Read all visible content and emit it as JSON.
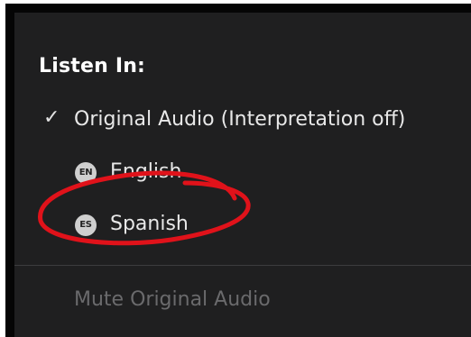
{
  "menu": {
    "heading": "Listen In:",
    "items": [
      {
        "label": "Original Audio (Interpretation off)",
        "checked": true,
        "check_glyph": "✓"
      },
      {
        "label": "English",
        "badge": "EN"
      },
      {
        "label": "Spanish",
        "badge": "ES"
      }
    ],
    "mute_label": "Mute Original Audio"
  },
  "colors": {
    "menu_bg": "#1f1f20",
    "text": "#e8e8e8",
    "disabled_text": "#6a6a6c",
    "annotation": "#e0121a"
  },
  "icons": {
    "check": "check-icon",
    "english_badge": "language-badge-en-icon",
    "spanish_badge": "language-badge-es-icon"
  }
}
